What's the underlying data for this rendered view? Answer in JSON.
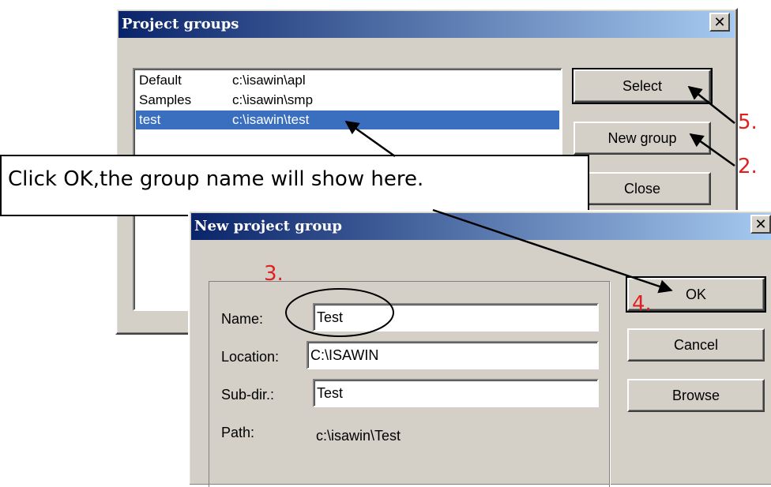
{
  "project_groups": {
    "title": "Project groups",
    "close_glyph": "✕",
    "list": [
      {
        "name": "Default",
        "path": "c:\\isawin\\apl"
      },
      {
        "name": "Samples",
        "path": "c:\\isawin\\smp"
      },
      {
        "name": "test",
        "path": "c:\\isawin\\test"
      }
    ],
    "selected_index": 2,
    "buttons": {
      "select": "Select",
      "new_group": "New group",
      "close": "Close"
    }
  },
  "callout": {
    "text": "Click OK,the group name will show here."
  },
  "new_project_group": {
    "title": "New project group",
    "close_glyph": "✕",
    "labels": {
      "name": "Name:",
      "location": "Location:",
      "subdir": "Sub-dir.:",
      "path": "Path:"
    },
    "values": {
      "name": "Test",
      "location": "C:\\ISAWIN",
      "subdir": "Test",
      "path": "c:\\isawin\\Test"
    },
    "buttons": {
      "ok": "OK",
      "cancel": "Cancel",
      "browse": "Browse"
    }
  },
  "steps": {
    "s2": "2.",
    "s3": "3.",
    "s4": "4.",
    "s5": "5."
  }
}
